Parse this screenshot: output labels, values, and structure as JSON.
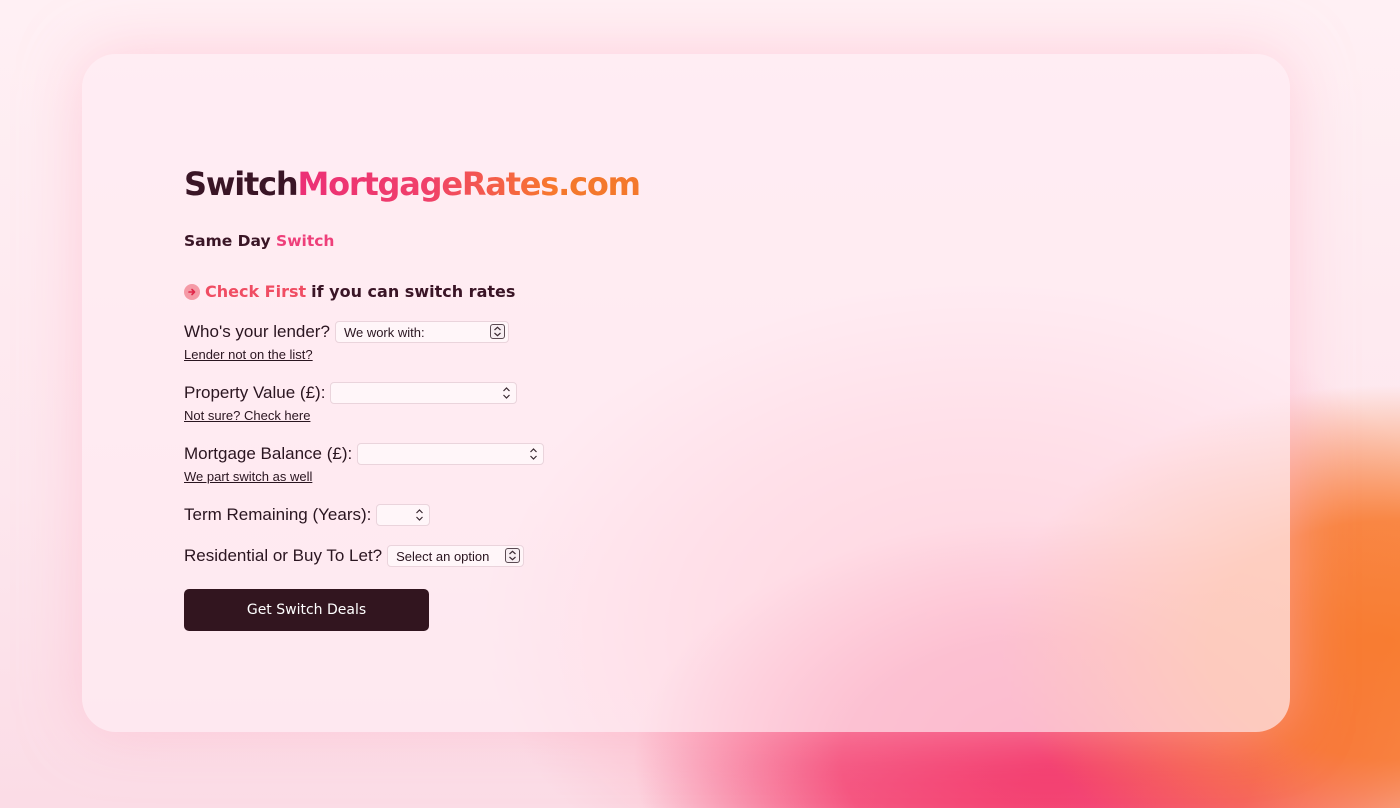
{
  "brand": {
    "part1": "Switch",
    "part2": "MortgageRates",
    "part3": ".com"
  },
  "tagline": {
    "prefix": "Same Day ",
    "accent": "Switch"
  },
  "check": {
    "icon": "arrow-right-circle-icon",
    "accent": "Check First",
    "rest": "if you can switch rates"
  },
  "form": {
    "lender": {
      "label": "Who's your lender?",
      "selected": "We work with:",
      "help_link": "Lender not on the list?"
    },
    "property_value": {
      "label": "Property Value (£):",
      "value": "",
      "help_link": "Not sure? Check here"
    },
    "mortgage_balance": {
      "label": "Mortgage Balance (£):",
      "value": "",
      "help_link": "We part switch as well"
    },
    "term_remaining": {
      "label": "Term Remaining (Years):",
      "value": ""
    },
    "property_type": {
      "label": "Residential or Buy To Let?",
      "selected": "Select an option"
    },
    "submit_label": "Get Switch Deals"
  },
  "colors": {
    "dark": "#32151f",
    "pink": "#ec2f76",
    "orange": "#f4782c"
  }
}
